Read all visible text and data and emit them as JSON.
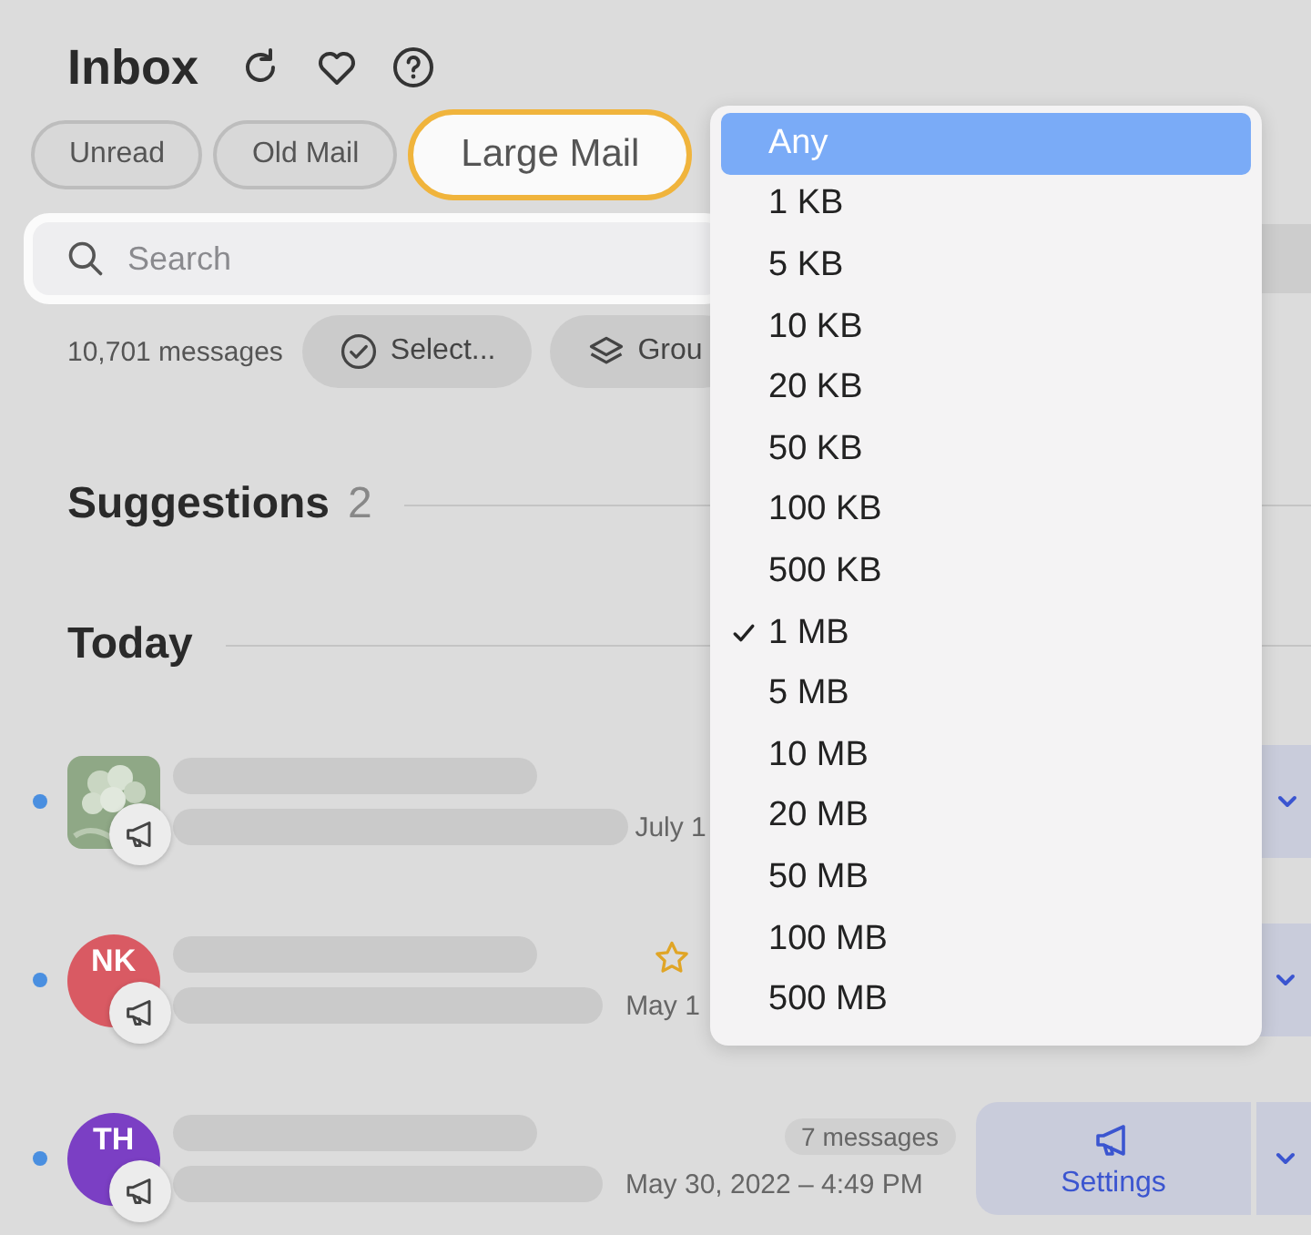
{
  "header": {
    "title": "Inbox"
  },
  "filters": [
    {
      "label": "Unread",
      "selected": false
    },
    {
      "label": "Old Mail",
      "selected": false
    },
    {
      "label": "Large Mail",
      "selected": true
    }
  ],
  "search": {
    "placeholder": "Search"
  },
  "toolbar": {
    "count": "10,701 messages",
    "buttons": [
      {
        "label": "Select...",
        "kind": "select"
      },
      {
        "label": "Grou",
        "kind": "group"
      }
    ]
  },
  "suggestions": {
    "title": "Suggestions",
    "count": "2"
  },
  "today": {
    "title": "Today"
  },
  "messages": [
    {
      "unread": true,
      "date": "July 1"
    },
    {
      "unread": true,
      "avatar": {
        "kind": "initials",
        "initials": "NK",
        "color": "#d95a63"
      },
      "date": "May 1",
      "starred": true
    },
    {
      "unread": true,
      "avatar": {
        "kind": "initials",
        "initials": "TH",
        "color": "#7b3fc4"
      },
      "count": "7 messages",
      "date": "May 30, 2022 – 4:49 PM",
      "action": "Settings"
    }
  ],
  "size_menu": {
    "options": [
      {
        "label": "Any",
        "highlighted": true,
        "checked": false
      },
      {
        "label": "1 KB",
        "highlighted": false,
        "checked": false
      },
      {
        "label": "5 KB",
        "highlighted": false,
        "checked": false
      },
      {
        "label": "10 KB",
        "highlighted": false,
        "checked": false
      },
      {
        "label": "20 KB",
        "highlighted": false,
        "checked": false
      },
      {
        "label": "50 KB",
        "highlighted": false,
        "checked": false
      },
      {
        "label": "100 KB",
        "highlighted": false,
        "checked": false
      },
      {
        "label": "500 KB",
        "highlighted": false,
        "checked": false
      },
      {
        "label": "1 MB",
        "highlighted": false,
        "checked": true
      },
      {
        "label": "5 MB",
        "highlighted": false,
        "checked": false
      },
      {
        "label": "10 MB",
        "highlighted": false,
        "checked": false
      },
      {
        "label": "20 MB",
        "highlighted": false,
        "checked": false
      },
      {
        "label": "50 MB",
        "highlighted": false,
        "checked": false
      },
      {
        "label": "100 MB",
        "highlighted": false,
        "checked": false
      },
      {
        "label": "500 MB",
        "highlighted": false,
        "checked": false
      }
    ]
  }
}
